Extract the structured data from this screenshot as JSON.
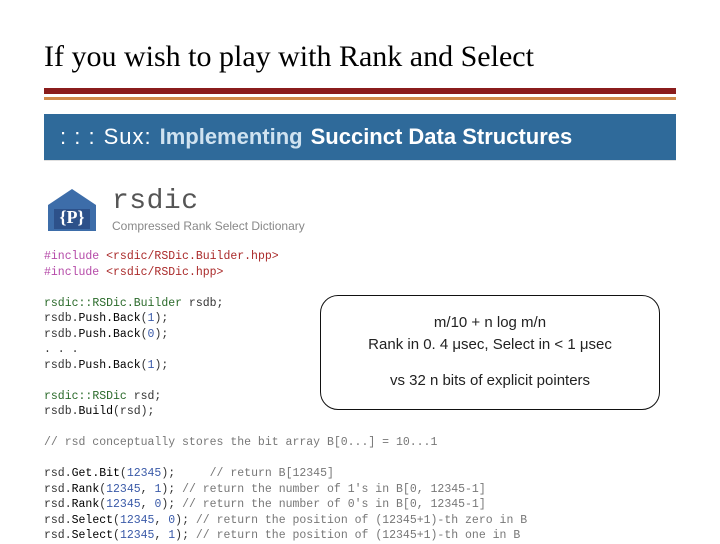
{
  "title": "If you wish to play with Rank and Select",
  "sux": {
    "prefix": ": : :",
    "name": "Sux:",
    "tag1": "Implementing",
    "tag2": "Succinct Data Structures"
  },
  "rsdic": {
    "name": "rsdic",
    "subtitle": "Compressed Rank Select Dictionary"
  },
  "code": {
    "l01a": "#include",
    "l01b": "<rsdic/RSDic.Builder.hpp>",
    "l02a": "#include",
    "l02b": "<rsdic/RSDic.hpp>",
    "l04a": "rsdic::",
    "l04b": "RSDic.Builder",
    "l04c": " rsdb;",
    "l05a": "rsdb.",
    "l05b": "Push.Back",
    "l05c": "(",
    "l05d": "1",
    "l05e": ");",
    "l06a": "rsdb.",
    "l06b": "Push.Back",
    "l06c": "(",
    "l06d": "0",
    "l06e": ");",
    "l07": ". . .",
    "l08a": "rsdb.",
    "l08b": "Push.Back",
    "l08c": "(",
    "l08d": "1",
    "l08e": ");",
    "l10a": "rsdic::",
    "l10b": "RSDic",
    "l10c": " rsd;",
    "l11a": "rsdb.",
    "l11b": "Build",
    "l11c": "(rsd);",
    "l13": "// rsd conceptually stores the bit array B[0...] = 10...1",
    "l15a": "rsd.",
    "l15b": "Get.Bit",
    "l15c": "(",
    "l15d": "12345",
    "l15e": ");     ",
    "l15f": "// return B[12345]",
    "l16a": "rsd.",
    "l16b": "Rank",
    "l16c": "(",
    "l16d": "12345",
    "l16e": ", ",
    "l16f": "1",
    "l16g": "); ",
    "l16h": "// return the number of 1's in B[0, 12345-1]",
    "l17a": "rsd.",
    "l17b": "Rank",
    "l17c": "(",
    "l17d": "12345",
    "l17e": ", ",
    "l17f": "0",
    "l17g": "); ",
    "l17h": "// return the number of 0's in B[0, 12345-1]",
    "l18a": "rsd.",
    "l18b": "Select",
    "l18c": "(",
    "l18d": "12345",
    "l18e": ", ",
    "l18f": "0",
    "l18g": "); ",
    "l18h": "// return the position of (12345+1)-th zero in B",
    "l19a": "rsd.",
    "l19b": "Select",
    "l19c": "(",
    "l19d": "12345",
    "l19e": ", ",
    "l19f": "1",
    "l19g": "); ",
    "l19h": "// return the position of (12345+1)-th one in B"
  },
  "callout": {
    "line1": "m/10 + n log m/n",
    "line2": "Rank in 0. 4 μsec, Select in < 1 μsec",
    "line3": "vs  32 n bits of explicit pointers"
  }
}
